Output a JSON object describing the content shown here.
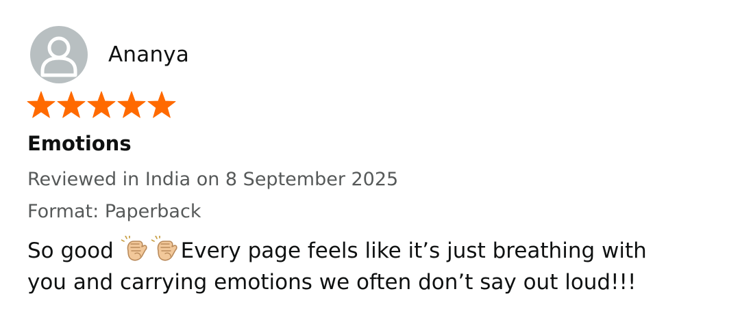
{
  "review": {
    "reviewer_name": "Ananya",
    "rating": 5,
    "rating_max": 5,
    "star_color": "#ff6a00",
    "title": "Emotions",
    "date_line": "Reviewed in India on 8 September 2025",
    "format_line": "Format: Paperback",
    "body": {
      "line1_start": "So good ",
      "line1_end": "Every page feels like it’s just breathing with",
      "line2": "you and carrying emotions we often don’t say out loud!!!"
    },
    "icons": {
      "avatar": "default-user-avatar-icon",
      "emoji": "clapping-hands-emoji"
    }
  }
}
